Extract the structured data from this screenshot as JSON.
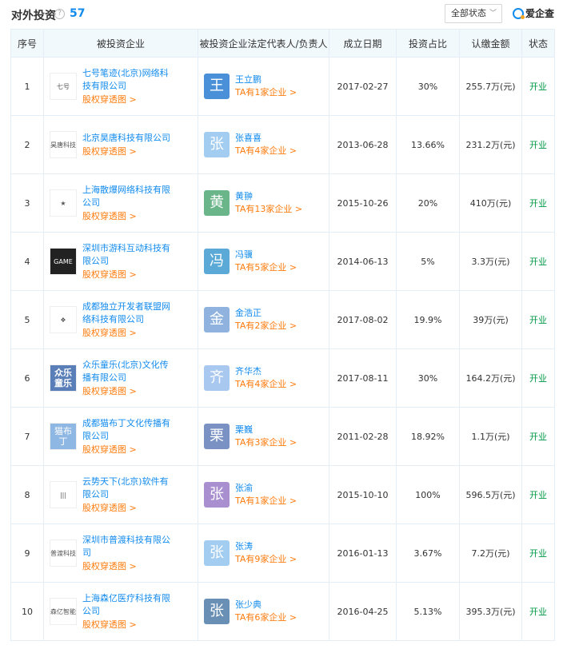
{
  "header": {
    "title": "对外投资",
    "help_icon": "?",
    "count": "57",
    "filter": "全部状态",
    "brand": "爱企查"
  },
  "columns": [
    "序号",
    "被投资企业",
    "被投资企业法定代表人/负责人",
    "成立日期",
    "投资占比",
    "认缴金额",
    "状态"
  ],
  "chart_link_label": "股权穿透图 >",
  "rows": [
    {
      "no": "1",
      "company": "七号笔迹(北京)网络科技有限公司",
      "logo_text": "七号",
      "logo_style": "light",
      "avatar": "王",
      "avatar_color": "#4a90d9",
      "rep": "王立鹏",
      "rep_link": "TA有1家企业 >",
      "date": "2017-02-27",
      "ratio": "30%",
      "amount": "255.7万(元)",
      "status": "开业"
    },
    {
      "no": "2",
      "company": "北京昊唐科技有限公司",
      "logo_text": "昊唐科技",
      "logo_style": "light",
      "avatar": "张",
      "avatar_color": "#a3cdf0",
      "rep": "张喜喜",
      "rep_link": "TA有4家企业 >",
      "date": "2013-06-28",
      "ratio": "13.66%",
      "amount": "231.2万(元)",
      "status": "开业"
    },
    {
      "no": "3",
      "company": "上海散爆网络科技有限公司",
      "logo_text": "★",
      "logo_style": "light",
      "avatar": "黄",
      "avatar_color": "#6ab58a",
      "rep": "黄翀",
      "rep_link": "TA有13家企业 >",
      "date": "2015-10-26",
      "ratio": "20%",
      "amount": "410万(元)",
      "status": "开业"
    },
    {
      "no": "4",
      "company": "深圳市游科互动科技有限公司",
      "logo_text": "GAME",
      "logo_style": "dark",
      "avatar": "冯",
      "avatar_color": "#5aa9d6",
      "rep": "冯骥",
      "rep_link": "TA有5家企业 >",
      "date": "2014-06-13",
      "ratio": "5%",
      "amount": "3.3万(元)",
      "status": "开业"
    },
    {
      "no": "5",
      "company": "成都独立开发者联盟网络科技有限公司",
      "logo_text": "❖",
      "logo_style": "light",
      "avatar": "金",
      "avatar_color": "#8fb3de",
      "rep": "金浩正",
      "rep_link": "TA有2家企业 >",
      "date": "2017-08-02",
      "ratio": "19.9%",
      "amount": "39万(元)",
      "status": "开业"
    },
    {
      "no": "6",
      "company": "众乐童乐(北京)文化传播有限公司",
      "logo_text": "众乐童乐",
      "logo_style": "blue",
      "avatar": "齐",
      "avatar_color": "#a9c8ef",
      "rep": "齐华杰",
      "rep_link": "TA有4家企业 >",
      "date": "2017-08-11",
      "ratio": "30%",
      "amount": "164.2万(元)",
      "status": "开业"
    },
    {
      "no": "7",
      "company": "成都猫布丁文化传播有限公司",
      "logo_text": "猫布丁",
      "logo_style": "lblue",
      "avatar": "栗",
      "avatar_color": "#7a91c4",
      "rep": "栗巍",
      "rep_link": "TA有3家企业 >",
      "date": "2011-02-28",
      "ratio": "18.92%",
      "amount": "1.1万(元)",
      "status": "开业"
    },
    {
      "no": "8",
      "company": "云势天下(北京)软件有限公司",
      "logo_text": "|||",
      "logo_style": "light",
      "avatar": "张",
      "avatar_color": "#a98fd0",
      "rep": "张渝",
      "rep_link": "TA有1家企业 >",
      "date": "2015-10-10",
      "ratio": "100%",
      "amount": "596.5万(元)",
      "status": "开业"
    },
    {
      "no": "9",
      "company": "深圳市普渡科技有限公司",
      "logo_text": "普渡科技",
      "logo_style": "light",
      "avatar": "张",
      "avatar_color": "#a3cdf0",
      "rep": "张涛",
      "rep_link": "TA有9家企业 >",
      "date": "2016-01-13",
      "ratio": "3.67%",
      "amount": "7.2万(元)",
      "status": "开业"
    },
    {
      "no": "10",
      "company": "上海森亿医疗科技有限公司",
      "logo_text": "森亿智能",
      "logo_style": "light",
      "avatar": "张",
      "avatar_color": "#6a8fb5",
      "rep": "张少典",
      "rep_link": "TA有6家企业 >",
      "date": "2016-04-25",
      "ratio": "5.13%",
      "amount": "395.3万(元)",
      "status": "开业"
    }
  ]
}
